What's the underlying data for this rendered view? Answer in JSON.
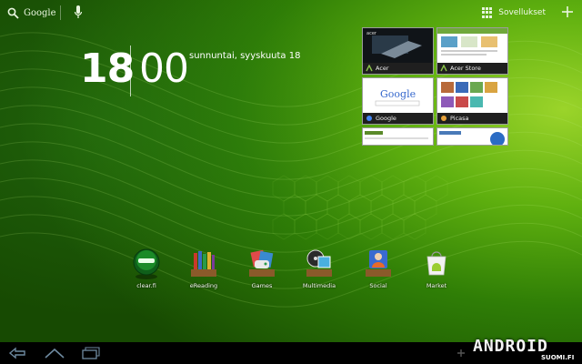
{
  "topbar": {
    "search_label": "Google",
    "apps_label": "Sovellukset"
  },
  "clock": {
    "hours": "18",
    "minutes": "00",
    "date": "sunnuntai, syyskuuta 18"
  },
  "recent_apps": [
    {
      "label": "Acer",
      "icon": "acer-icon"
    },
    {
      "label": "Acer Store",
      "icon": "acer-icon"
    },
    {
      "label": "Google",
      "icon": "google-icon"
    },
    {
      "label": "Picasa",
      "icon": "picasa-icon"
    }
  ],
  "dock": [
    {
      "label": "clear.fi",
      "icon": "clearfi-icon"
    },
    {
      "label": "eReading",
      "icon": "ereading-icon"
    },
    {
      "label": "Games",
      "icon": "games-icon"
    },
    {
      "label": "Multimedia",
      "icon": "multimedia-icon"
    },
    {
      "label": "Social",
      "icon": "social-icon"
    },
    {
      "label": "Market",
      "icon": "market-icon"
    }
  ],
  "thumb_texts": {
    "google_logo": "Google",
    "acer_logo": "acer"
  },
  "watermark": {
    "brand": "ANDROID",
    "sub": "SUOMI.FI"
  },
  "colors": {
    "wallpaper": "#2f7e06",
    "accent": "#9bd42a",
    "system_bar": "#000000"
  }
}
